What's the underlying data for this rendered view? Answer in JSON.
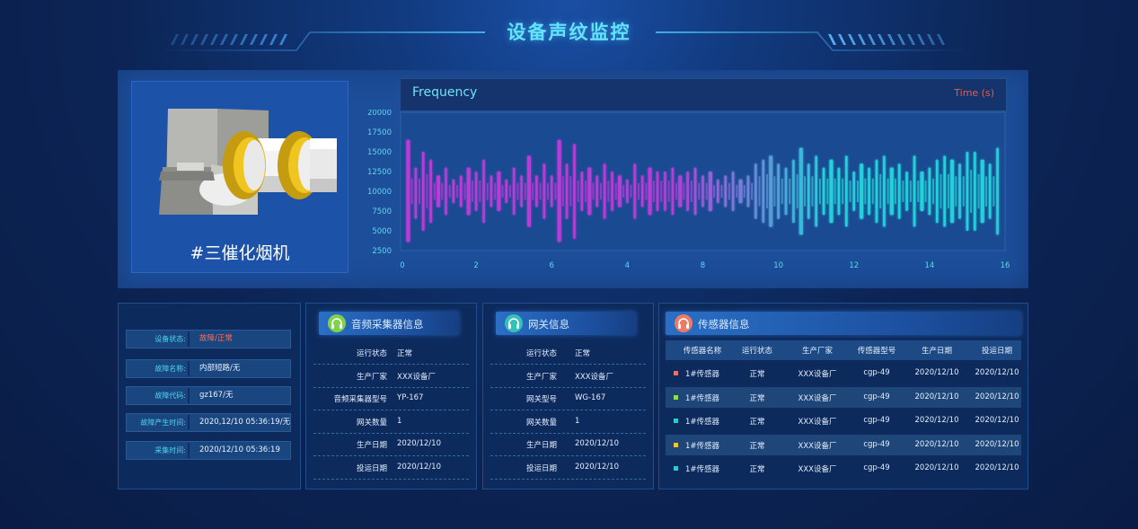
{
  "header": {
    "title": "设备声纹监控"
  },
  "machine": {
    "name": "#三催化烟机"
  },
  "chart": {
    "freq_label": "Frequency",
    "time_label": "Time (s)"
  },
  "chart_data": {
    "type": "bar",
    "title": "",
    "xlabel": "",
    "ylabel": "",
    "y_ticks": [
      "20000",
      "17500",
      "15000",
      "12500",
      "10000",
      "7500",
      "5000",
      "2500"
    ],
    "x_ticks": [
      "0",
      "2",
      "6",
      "4",
      "8",
      "10",
      "12",
      "14",
      "16"
    ],
    "xlim": [
      0,
      16
    ],
    "ylim": [
      2500,
      20000
    ],
    "center": 10000,
    "colors": {
      "start": "#b93ad8",
      "end": "#22d2d8"
    },
    "series": [
      {
        "x": [
          0.2,
          0.4,
          0.6,
          0.8,
          1.0,
          1.2,
          1.4,
          1.6,
          1.8,
          2.0,
          2.2,
          2.4,
          2.6,
          2.8,
          3.0,
          3.2,
          3.4,
          3.6,
          3.8,
          4.0,
          4.2,
          4.4,
          4.6,
          4.8,
          5.0,
          5.2,
          5.4,
          5.6,
          5.8,
          6.0,
          6.2,
          6.4,
          6.6,
          6.8,
          7.0,
          7.2,
          7.4,
          7.6,
          7.8,
          8.0,
          8.2,
          8.4,
          8.6,
          8.8,
          9.0,
          9.2,
          9.4,
          9.6,
          9.8,
          10.0,
          10.2,
          10.4,
          10.6,
          10.8,
          11.0,
          11.2,
          11.4,
          11.6,
          11.8,
          12.0,
          12.2,
          12.4,
          12.6,
          12.8,
          13.0,
          13.2,
          13.4,
          13.6,
          13.8,
          14.0,
          14.2,
          14.4,
          14.6,
          14.8,
          15.0,
          15.2,
          15.4,
          15.6,
          15.8
        ],
        "high": [
          16500,
          13000,
          15000,
          14000,
          12000,
          13000,
          11500,
          12000,
          13000,
          12500,
          14000,
          12000,
          12500,
          11500,
          13000,
          12000,
          14500,
          12000,
          13500,
          12000,
          16500,
          13500,
          16000,
          12500,
          13000,
          12000,
          13500,
          12500,
          12000,
          11500,
          13500,
          12000,
          13000,
          12500,
          12500,
          13000,
          12000,
          12500,
          13000,
          12000,
          12500,
          11500,
          12000,
          12500,
          11500,
          12000,
          13500,
          14000,
          14500,
          13500,
          13000,
          14000,
          15500,
          13500,
          14500,
          13000,
          14000,
          13000,
          14500,
          12500,
          13500,
          13000,
          14000,
          14500,
          13000,
          13500,
          12500,
          14500,
          12500,
          13000,
          14000,
          14500,
          14000,
          13500,
          15000,
          15000,
          14000,
          13500,
          15500
        ],
        "low": [
          3600,
          6500,
          5000,
          6000,
          8000,
          7000,
          8500,
          8000,
          7000,
          7500,
          6000,
          8000,
          7500,
          8500,
          7000,
          8000,
          5500,
          8000,
          6500,
          8000,
          3600,
          6500,
          4000,
          7500,
          7000,
          8000,
          6500,
          7500,
          8000,
          8500,
          6500,
          8000,
          7000,
          7500,
          7500,
          7000,
          8000,
          7500,
          7000,
          8000,
          7500,
          8500,
          8000,
          7500,
          8500,
          8000,
          6500,
          6000,
          5500,
          6500,
          7000,
          6000,
          4500,
          6500,
          5500,
          7000,
          6000,
          7000,
          5500,
          7500,
          6500,
          7000,
          6000,
          5500,
          7000,
          6500,
          7500,
          5500,
          7500,
          7000,
          6000,
          5500,
          6000,
          6500,
          5000,
          5000,
          6000,
          6500,
          4500
        ]
      }
    ]
  },
  "status": {
    "rows": [
      {
        "key": "设备状态:",
        "value": "故障/正常",
        "alert": true
      },
      {
        "key": "故障名称:",
        "value": "内部短路/无"
      },
      {
        "key": "故障代码:",
        "value": "gz167/无"
      },
      {
        "key": "故障产生时间:",
        "value": "2020,12/10    05:36:19/无"
      },
      {
        "key": "采集时间:",
        "value": "2020/12/10    05:36:19"
      }
    ]
  },
  "audio": {
    "title": "音频采集器信息",
    "rows": [
      {
        "key": "运行状态",
        "value": "正常"
      },
      {
        "key": "生产厂家",
        "value": "XXX设备厂"
      },
      {
        "key": "音频采集器型号",
        "value": "YP-167"
      },
      {
        "key": "网关数量",
        "value": "1"
      },
      {
        "key": "生产日期",
        "value": "2020/12/10"
      },
      {
        "key": "投运日期",
        "value": "2020/12/10"
      }
    ]
  },
  "gateway": {
    "title": "网关信息",
    "rows": [
      {
        "key": "运行状态",
        "value": "正常"
      },
      {
        "key": "生产厂家",
        "value": "XXX设备厂"
      },
      {
        "key": "网关型号",
        "value": "WG-167"
      },
      {
        "key": "网关数量",
        "value": "1"
      },
      {
        "key": "生产日期",
        "value": "2020/12/10"
      },
      {
        "key": "投运日期",
        "value": "2020/12/10"
      }
    ]
  },
  "sensor": {
    "title": "传感器信息",
    "columns": [
      "传感器名称",
      "运行状态",
      "生产厂家",
      "传感器型号",
      "生产日期",
      "投运日期"
    ],
    "rows": [
      {
        "color": "#e8736a",
        "cells": [
          "1#传感器",
          "正常",
          "XXX设备厂",
          "cgp-49",
          "2020/12/10",
          "2020/12/10"
        ]
      },
      {
        "color": "#8ee04a",
        "cells": [
          "1#传感器",
          "正常",
          "XXX设备厂",
          "cgp-49",
          "2020/12/10",
          "2020/12/10"
        ]
      },
      {
        "color": "#2fc9d2",
        "cells": [
          "1#传感器",
          "正常",
          "XXX设备厂",
          "cgp-49",
          "2020/12/10",
          "2020/12/10"
        ]
      },
      {
        "color": "#f2c230",
        "cells": [
          "1#传感器",
          "正常",
          "XXX设备厂",
          "cgp-49",
          "2020/12/10",
          "2020/12/10"
        ]
      },
      {
        "color": "#2fc9d2",
        "cells": [
          "1#传感器",
          "正常",
          "XXX设备厂",
          "cgp-49",
          "2020/12/10",
          "2020/12/10"
        ]
      }
    ]
  }
}
